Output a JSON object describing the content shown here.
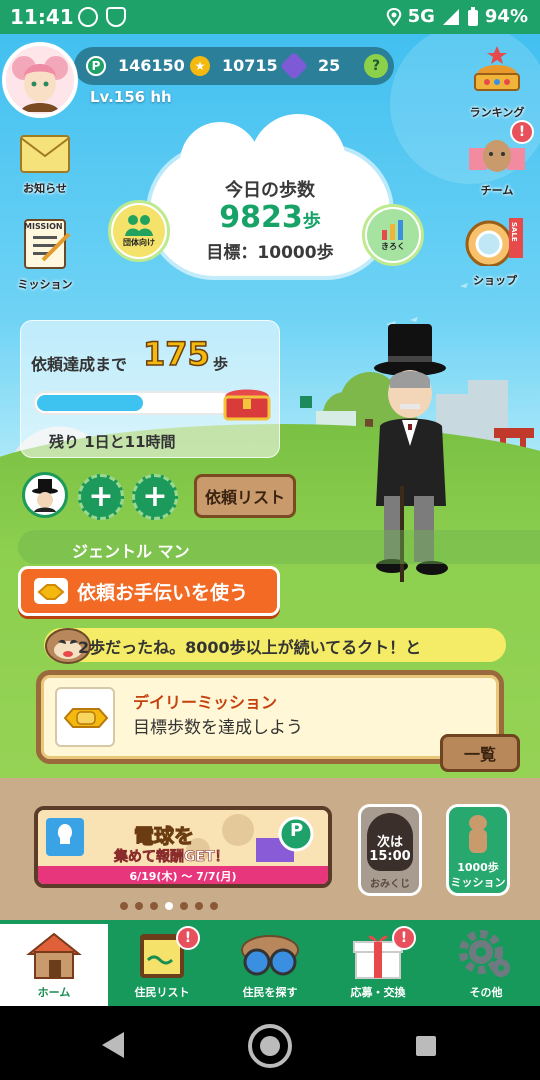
{
  "status_bar": {
    "time": "11:41",
    "network": "5G",
    "battery": "94%"
  },
  "header": {
    "points": "146150",
    "coins": "10715",
    "gems": "25",
    "help_label": "?",
    "level": "Lv.156 hh"
  },
  "side_buttons": {
    "news": "お知らせ",
    "mission": "ミッション",
    "mission_card_text": "MISSION",
    "ranking": "ランキング",
    "team": "チーム",
    "shop": "ショップ",
    "sale_tag": "SALE"
  },
  "badge_mark": "!",
  "steps": {
    "title": "今日の歩数",
    "count": "9823",
    "unit": "歩",
    "goal": "目標：10000歩"
  },
  "round_buttons": {
    "group": "団体向け",
    "record": "きろく"
  },
  "request": {
    "label": "依頼達成まで",
    "number": "175",
    "unit": "歩",
    "progress": 0.55,
    "remaining": "残り 1日と11時間",
    "list_button": "依頼リスト",
    "plus": "+"
  },
  "character_name": "ジェントル マン",
  "help_button": "依頼お手伝いを使う",
  "message": "2歩だったね。8000歩以上が続いてるクト！と",
  "daily_mission": {
    "title": "デイリーミッション",
    "description": "目標歩数を達成しよう",
    "list_button": "一覧"
  },
  "banner": {
    "title": "電球を",
    "subtitle": "集めて報酬GET！",
    "p_mark": "P",
    "date": "6/19(木) ～ 7/7(月)"
  },
  "omikuji": {
    "line1": "次は",
    "line2": "15:00",
    "label": "おみくじ"
  },
  "mission1000": {
    "line1": "1000歩",
    "line2": "ミッション"
  },
  "carousel": {
    "count": 7,
    "active": 3
  },
  "bottom_nav": [
    {
      "label": "ホーム",
      "active": true
    },
    {
      "label": "住民リスト",
      "badge": true
    },
    {
      "label": "住民を探す"
    },
    {
      "label": "応募・交換",
      "badge": true
    },
    {
      "label": "その他"
    }
  ],
  "colors": {
    "brand_green": "#18995c",
    "step_green": "#17a267",
    "orange": "#f26a23",
    "sky": "#42c0f0"
  }
}
